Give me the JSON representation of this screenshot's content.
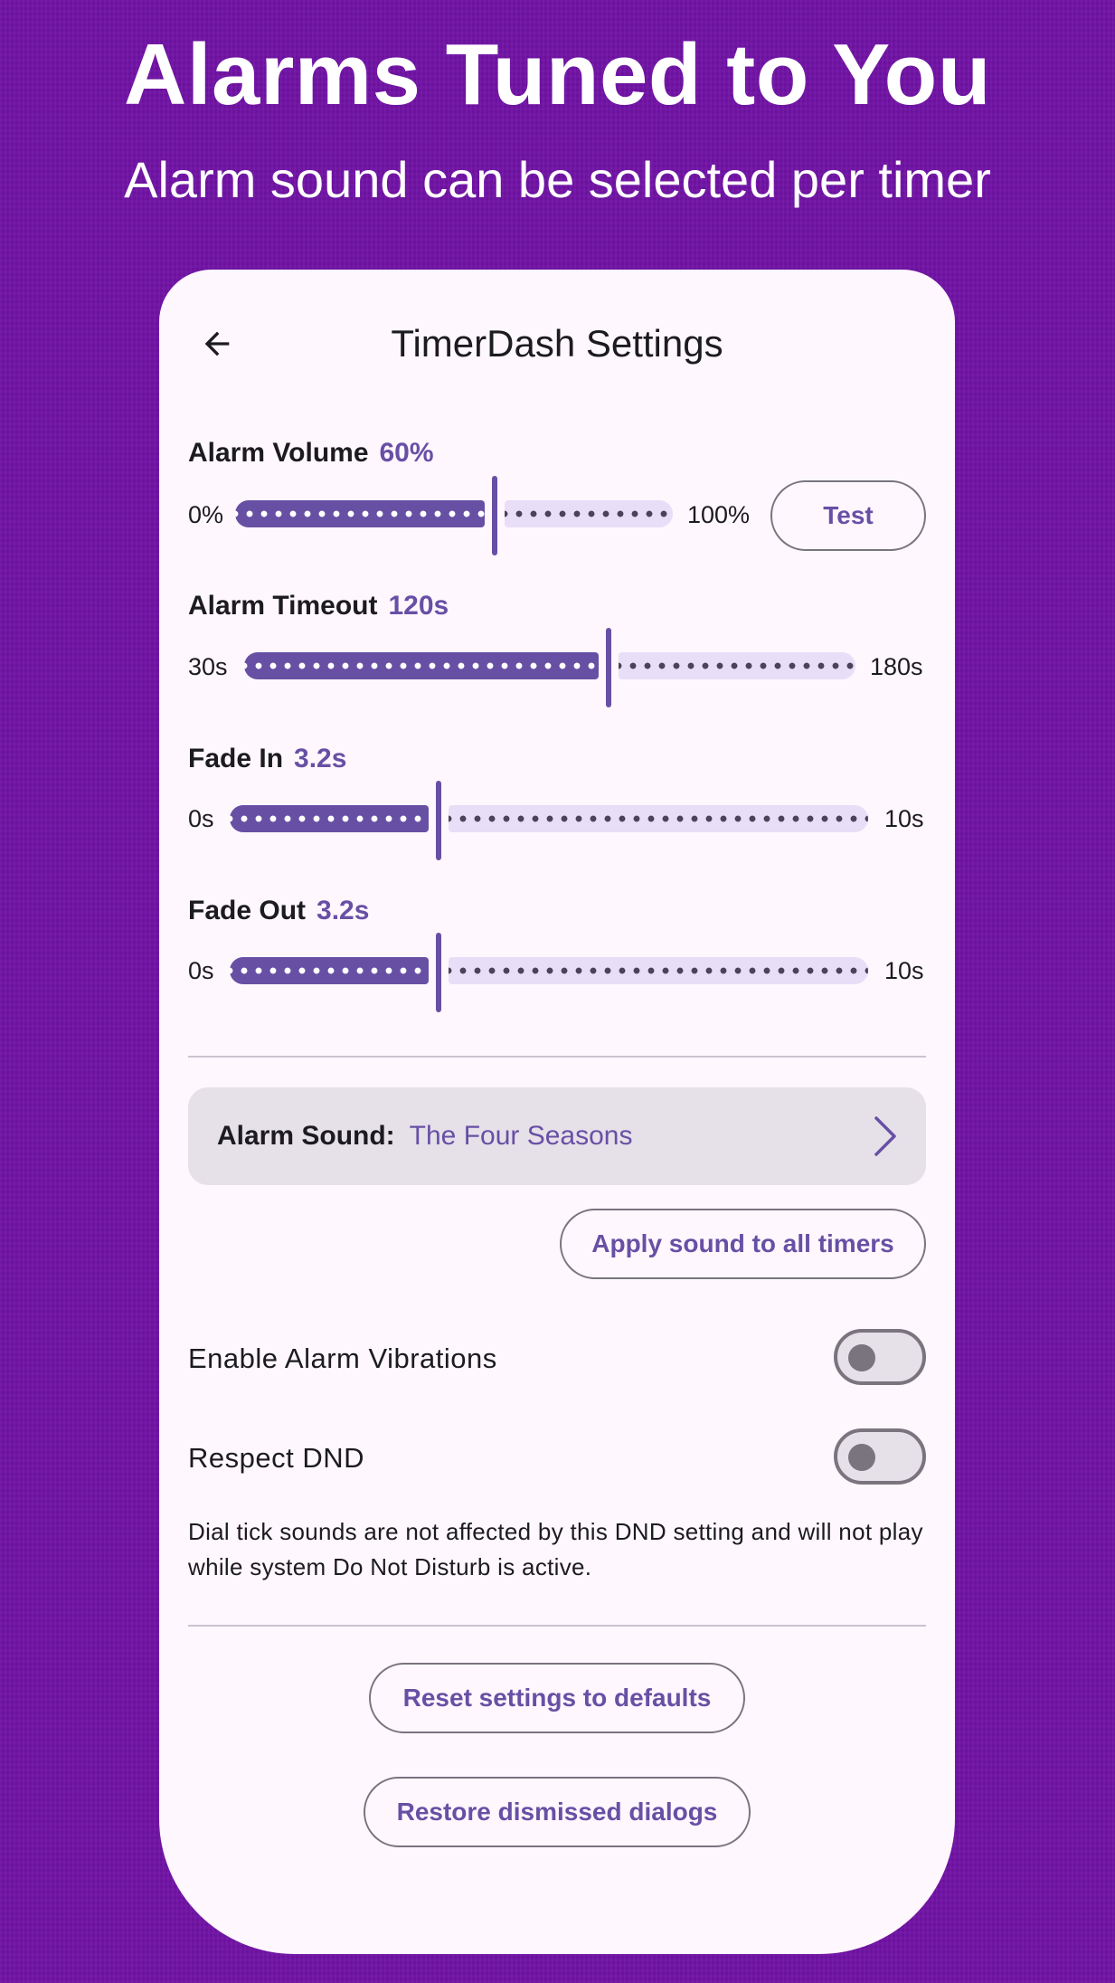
{
  "hero": {
    "headline": "Alarms Tuned to You",
    "subhead": "Alarm sound can be selected per timer"
  },
  "header": {
    "title": "TimerDash Settings",
    "back_icon": "arrow-left-icon"
  },
  "sliders": {
    "volume": {
      "label": "Alarm Volume",
      "value": "60%",
      "min": "0%",
      "max": "100%",
      "fraction": 0.6
    },
    "timeout": {
      "label": "Alarm Timeout",
      "value": "120s",
      "min": "30s",
      "max": "180s",
      "fraction": 0.6
    },
    "fade_in": {
      "label": "Fade In",
      "value": "3.2s",
      "min": "0s",
      "max": "10s",
      "fraction": 0.32
    },
    "fade_out": {
      "label": "Fade Out",
      "value": "3.2s",
      "min": "0s",
      "max": "10s",
      "fraction": 0.32
    }
  },
  "test_button": "Test",
  "alarm_sound": {
    "label": "Alarm Sound:",
    "value": "The Four Seasons",
    "chevron_icon": "chevron-right-icon"
  },
  "apply_button": "Apply sound to all timers",
  "toggles": {
    "vibrations": {
      "label": "Enable Alarm Vibrations",
      "on": false
    },
    "dnd": {
      "label": "Respect DND",
      "on": false
    }
  },
  "dnd_note": "Dial tick sounds are not affected by this DND setting and will not play while system Do Not Disturb is active.",
  "reset_button": "Reset settings to defaults",
  "restore_button": "Restore dismissed dialogs",
  "colors": {
    "background": "#7112A6",
    "card": "#FEF7FE",
    "accent": "#6750A4",
    "track_inactive": "#E8DEF8"
  }
}
